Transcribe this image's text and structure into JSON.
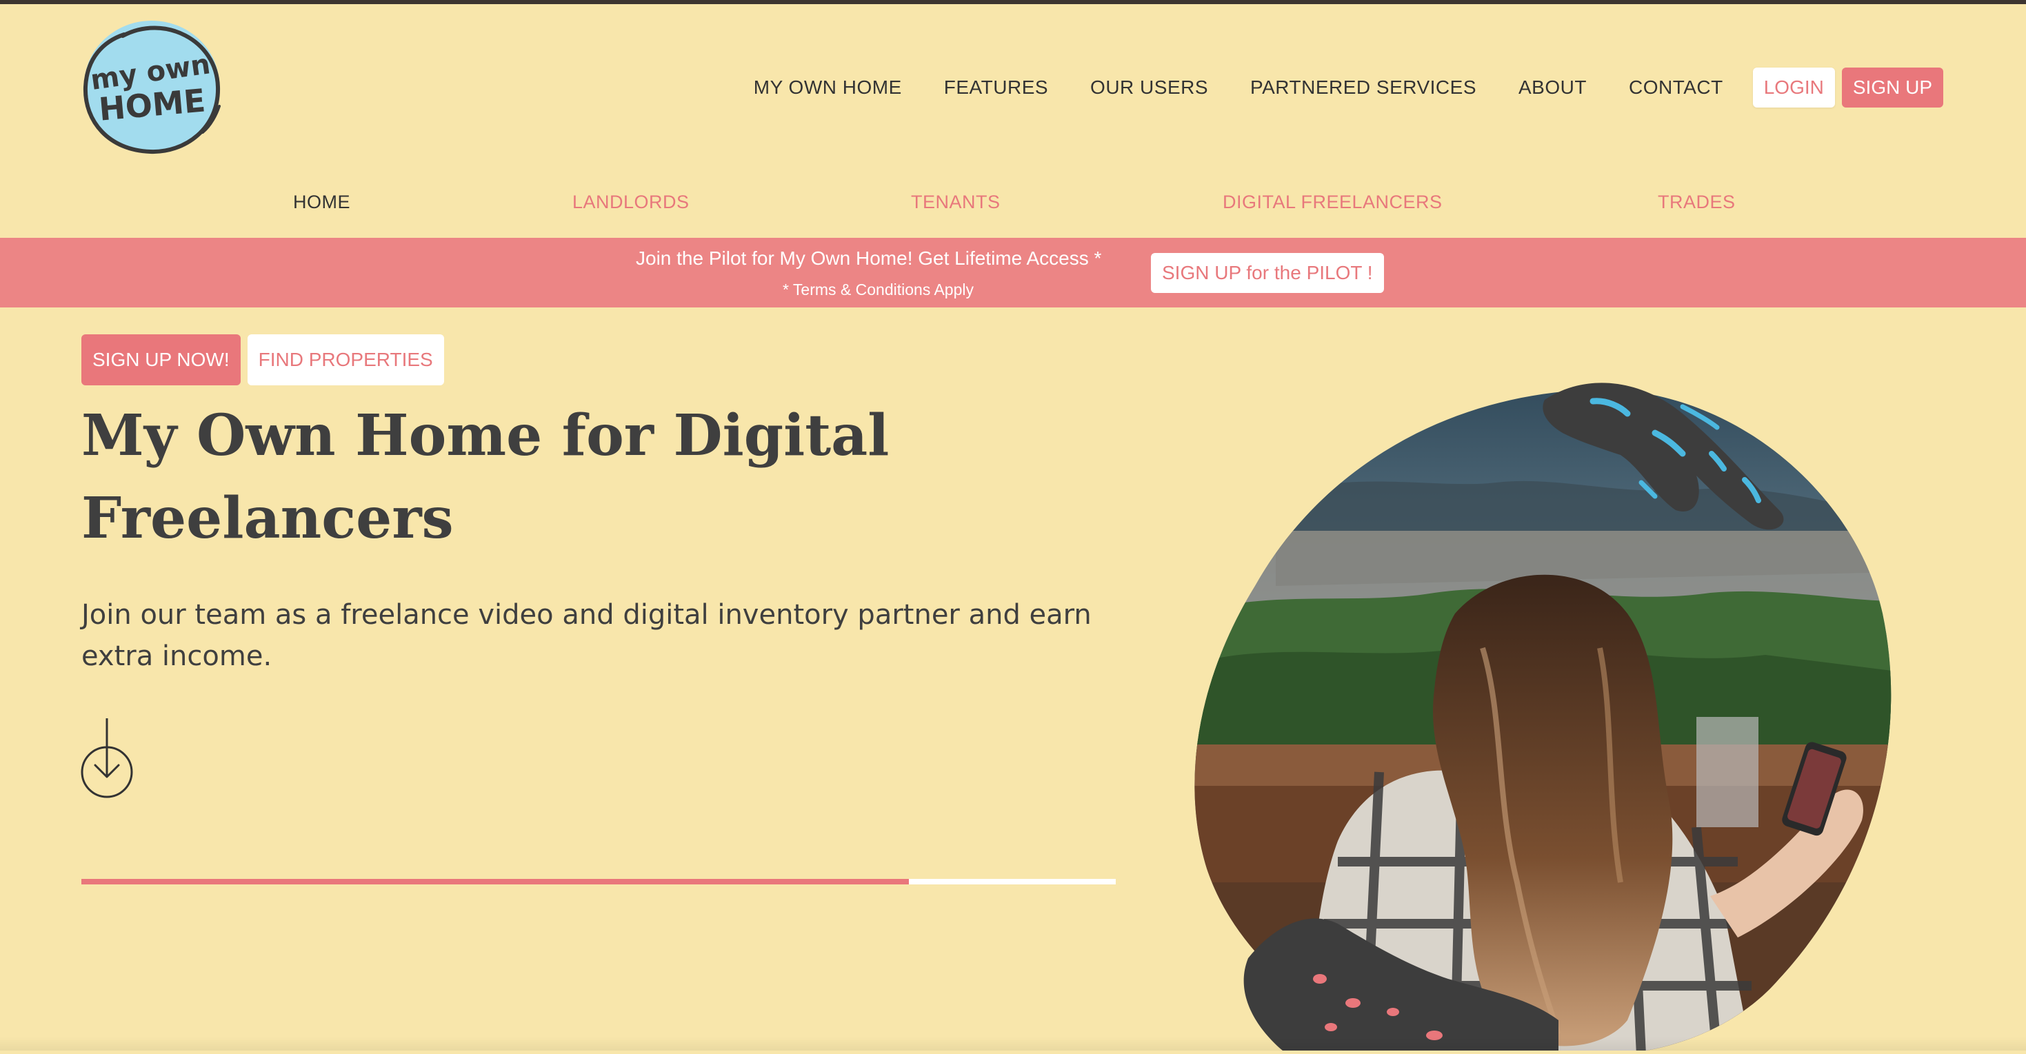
{
  "logo": {
    "line1": "my own",
    "line2": "HOME",
    "circle_color": "#a2dcee"
  },
  "nav": {
    "items": [
      "MY OWN HOME",
      "FEATURES",
      "OUR USERS",
      "PARTNERED SERVICES",
      "ABOUT",
      "CONTACT"
    ],
    "login_label": "LOGIN",
    "signup_label": "SIGN UP"
  },
  "subnav": {
    "items": [
      {
        "label": "HOME",
        "active": true
      },
      {
        "label": "LANDLORDS",
        "active": false
      },
      {
        "label": "TENANTS",
        "active": false
      },
      {
        "label": "DIGITAL FREELANCERS",
        "active": false
      },
      {
        "label": "TRADES",
        "active": false
      }
    ]
  },
  "banner": {
    "text": "Join the Pilot for My Own Home! Get Lifetime Access *",
    "terms": "* Terms & Conditions Apply",
    "button_label": "SIGN UP for the PILOT !"
  },
  "hero": {
    "primary_cta": "SIGN UP NOW!",
    "secondary_cta": "FIND PROPERTIES",
    "title": "My Own Home for Digital Freelancers",
    "subtitle": "Join our team as a freelance video and digital inventory partner and earn extra income.",
    "scroll_icon": "arrow-down-circle-icon",
    "progress_percent": 80
  },
  "colors": {
    "background": "#f8e6ab",
    "accent": "#e9777b",
    "banner": "#ec8585",
    "text": "#3f3f3f",
    "splash_blue": "#4bb8e0"
  }
}
